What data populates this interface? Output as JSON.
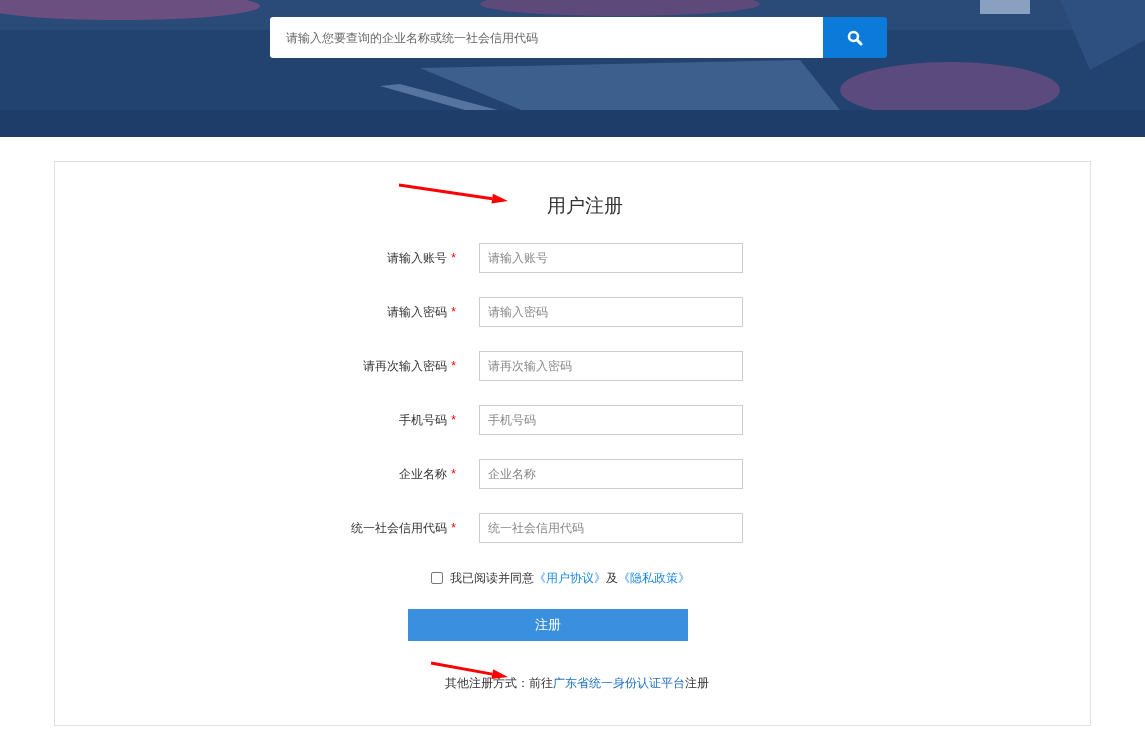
{
  "search": {
    "placeholder": "请输入您要查询的企业名称或统一社会信用代码"
  },
  "form": {
    "title": "用户注册",
    "fields": [
      {
        "label": "请输入账号",
        "required": true,
        "placeholder": "请输入账号"
      },
      {
        "label": "请输入密码",
        "required": true,
        "placeholder": "请输入密码"
      },
      {
        "label": "请再次输入密码",
        "required": true,
        "placeholder": "请再次输入密码"
      },
      {
        "label": "手机号码",
        "required": true,
        "placeholder": "手机号码"
      },
      {
        "label": "企业名称",
        "required": true,
        "placeholder": "企业名称"
      },
      {
        "label": "统一社会信用代码",
        "required": true,
        "placeholder": "统一社会信用代码"
      }
    ],
    "required_mark": "*",
    "agreement": {
      "checked": false,
      "text": "我已阅读并同意",
      "link_1": "《用户协议》",
      "conjunction": "及",
      "link_2": "《隐私政策》"
    },
    "submit": "注册",
    "other": {
      "prefix": "其他注册方式：前往",
      "link": "广东省统一身份认证平台",
      "suffix": "注册"
    }
  }
}
